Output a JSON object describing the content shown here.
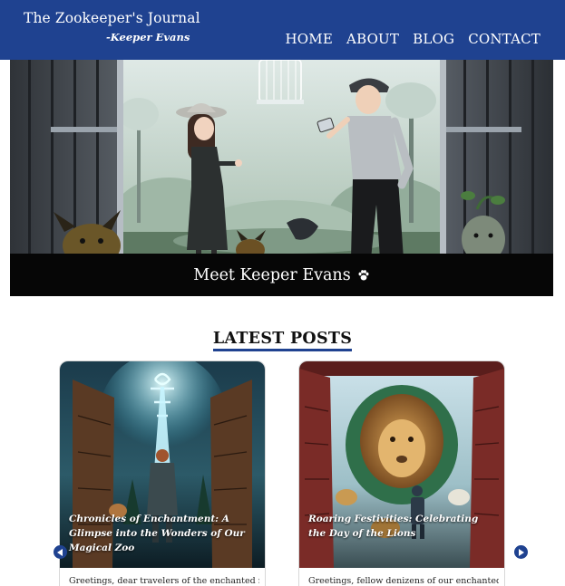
{
  "header": {
    "title": "The Zookeeper's Journal",
    "subtitle": "-Keeper Evans",
    "nav": [
      "HOME",
      "ABOUT",
      "BLOG",
      "CONTACT"
    ]
  },
  "hero": {
    "caption": "Meet Keeper Evans",
    "caption_icon": "paw-icon"
  },
  "latest": {
    "heading": "LATEST POSTS",
    "posts": [
      {
        "title": "Chronicles of Enchantment: A Glimpse into the Wonders of Our Magical Zoo",
        "excerpt": "Greetings, dear travelers of the enchanted realm,"
      },
      {
        "title": "Roaring Festivities: Celebrating the Day of the Lions",
        "excerpt": "Greetings, fellow denizens of our enchanted realm!"
      }
    ]
  },
  "colors": {
    "brand": "#1f4290",
    "caption_bg": "#060606"
  }
}
